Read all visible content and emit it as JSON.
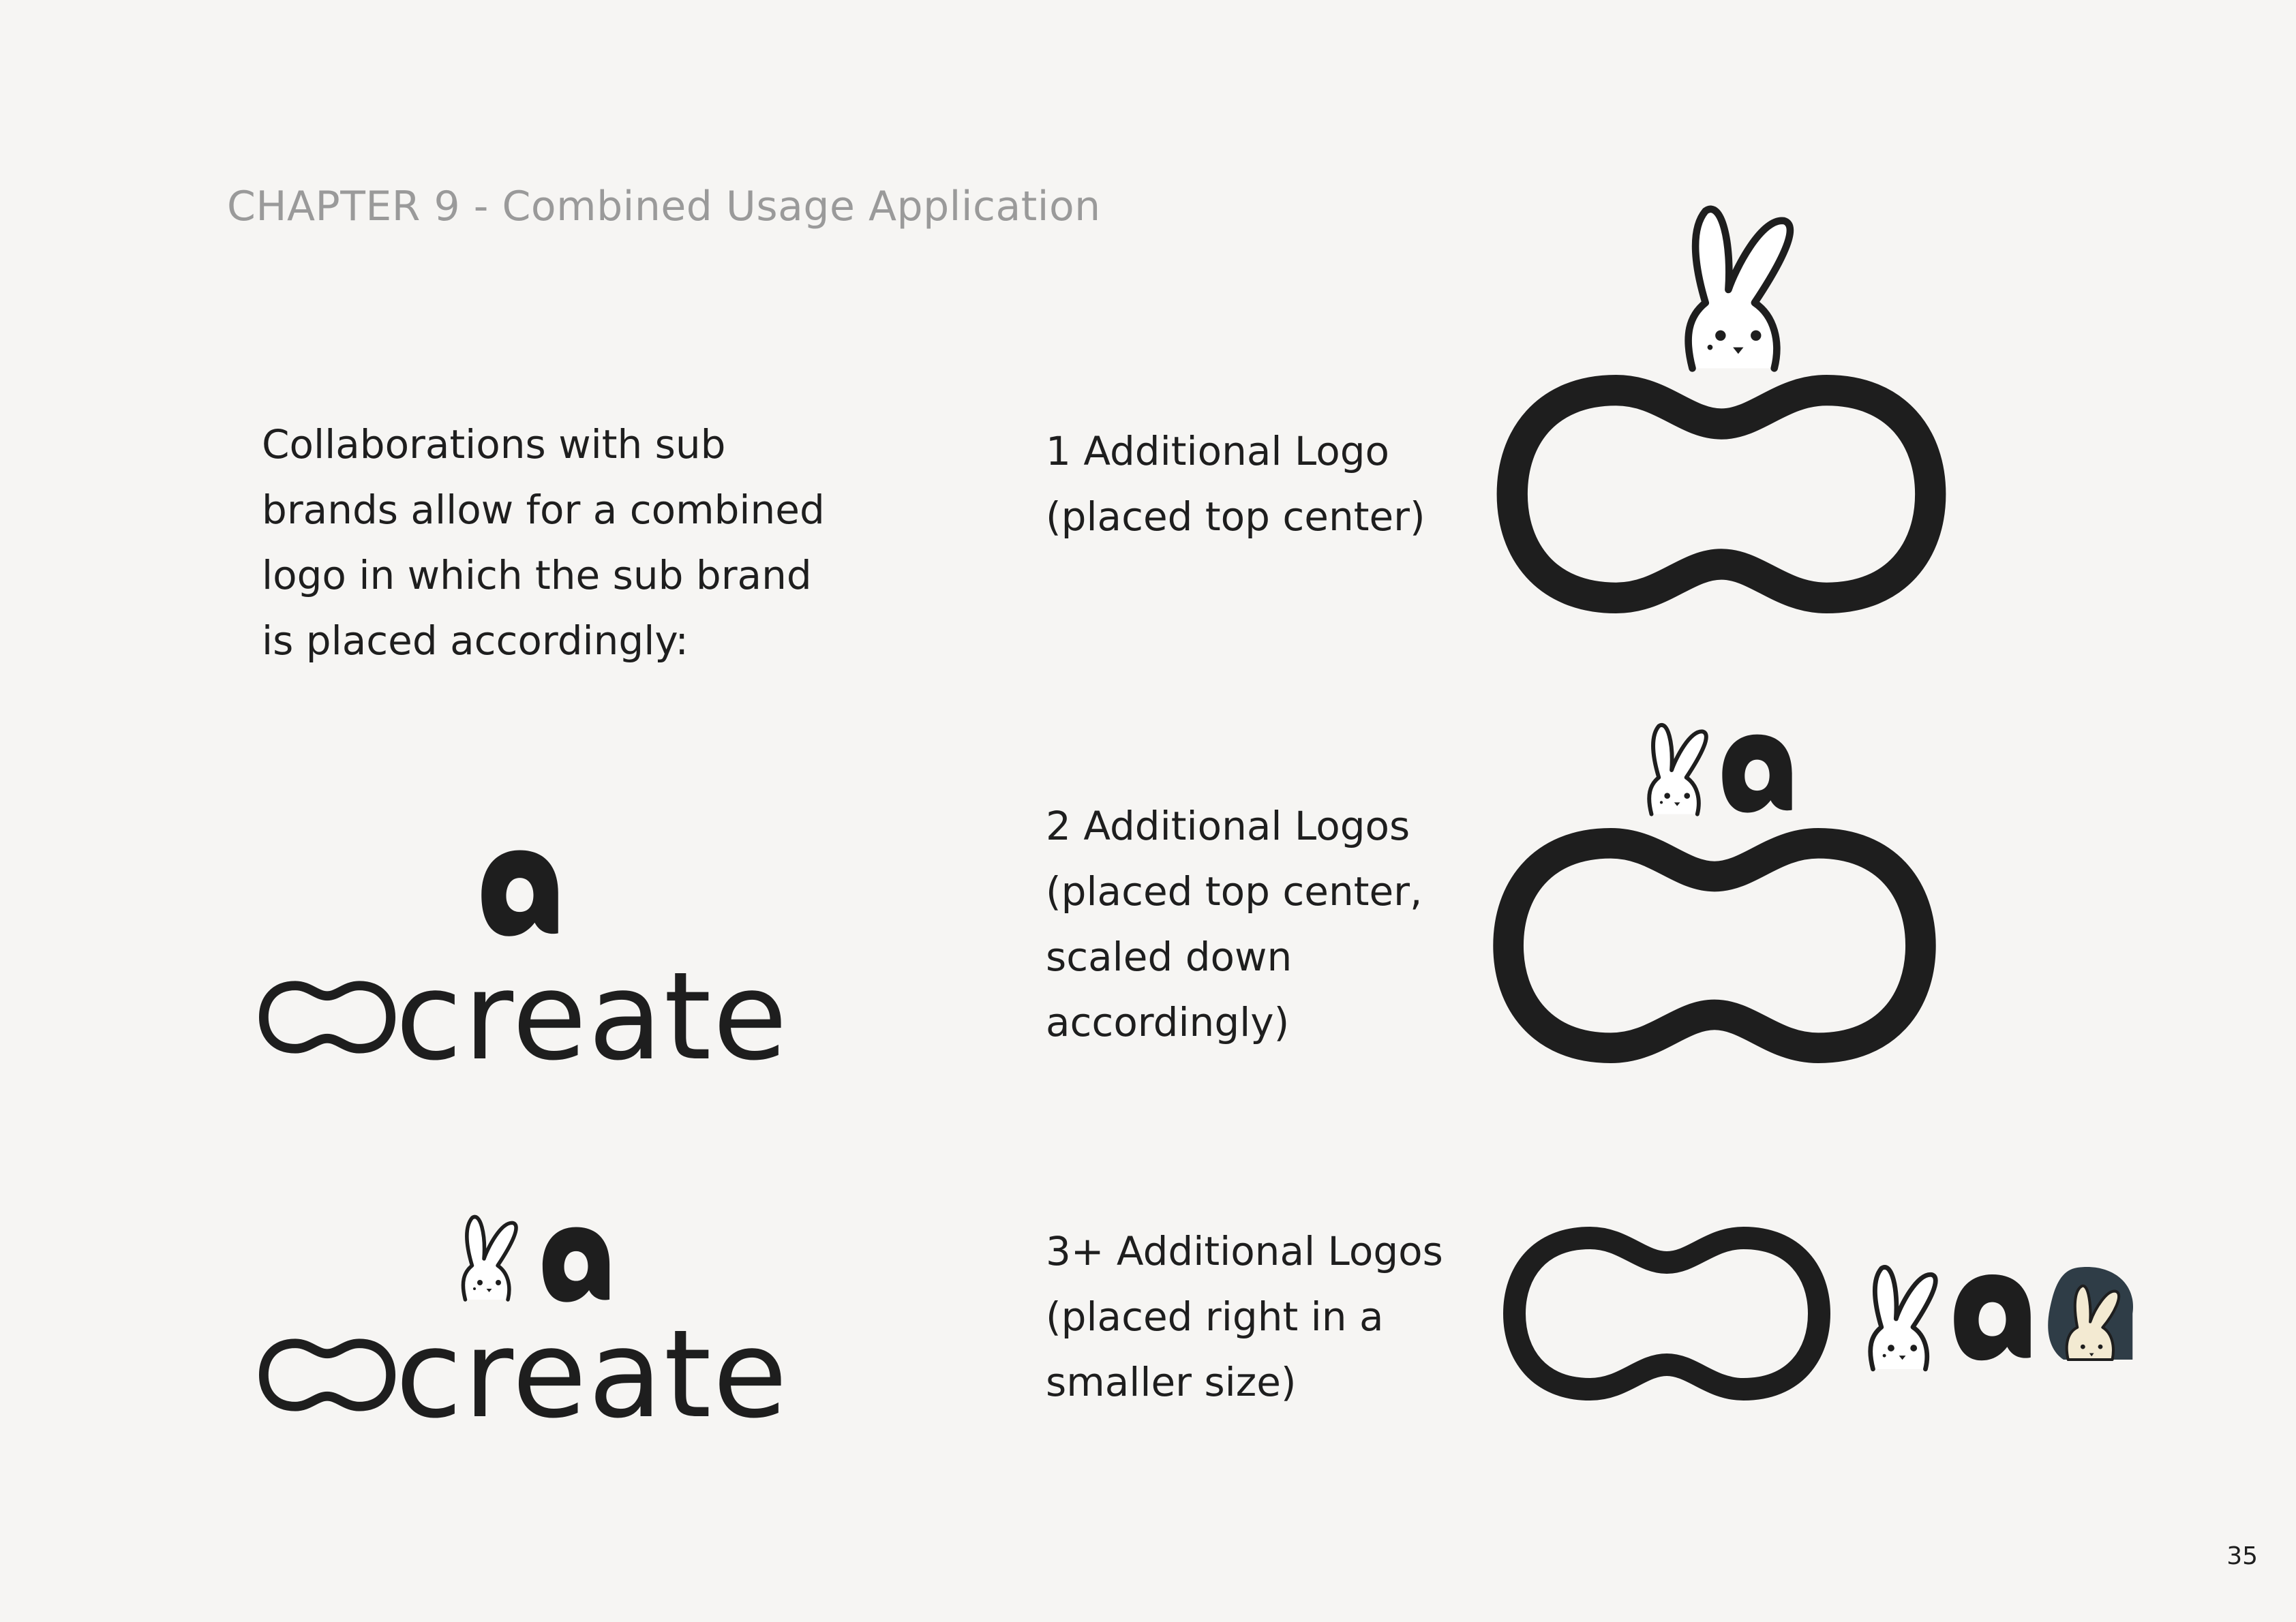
{
  "header": {
    "chapter_title": "CHAPTER 9 - Combined Usage Application"
  },
  "intro": {
    "lines": [
      "Collaborations with sub",
      "brands allow for a combined",
      "logo in which the sub brand",
      "is placed accordingly:"
    ]
  },
  "wordmark": {
    "text": "create"
  },
  "variants": [
    {
      "lines": [
        "1 Additional Logo",
        "(placed top center)"
      ]
    },
    {
      "lines": [
        "2 Additional Logos",
        "(placed top center,",
        "scaled down",
        "accordingly)"
      ]
    },
    {
      "lines": [
        "3+  Additional Logos",
        "(placed right in a",
        "smaller size)"
      ]
    }
  ],
  "icons": {
    "main_logo": "infinity-loop-icon",
    "sub_brand_1": "bunny-icon",
    "sub_brand_2": "letter-a-icon",
    "sub_brand_3": "bunny-badge-icon"
  },
  "colors": {
    "background": "#f6f5f3",
    "ink": "#1e1e1e",
    "chapter_gray": "#9a9a9a",
    "badge_dark": "#2f3d47",
    "badge_bunny": "#f3ead2"
  },
  "footer": {
    "page_number": "35"
  }
}
